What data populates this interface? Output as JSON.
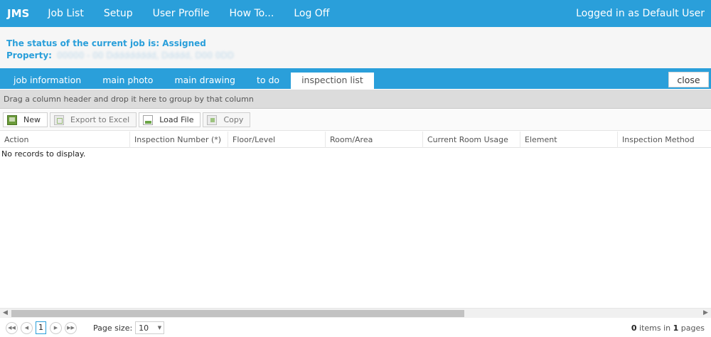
{
  "nav": {
    "brand": "JMS",
    "links": [
      "Job List",
      "Setup",
      "User Profile",
      "How To...",
      "Log Off"
    ],
    "user": "Logged in as Default User"
  },
  "status": {
    "line1": "The status of the current job is: Assigned",
    "property_label": "Property:",
    "property_value": "00000 - 00 Ddddddddd, Ddddd, D00 0DD"
  },
  "tabs": {
    "items": [
      "job information",
      "main photo",
      "main drawing",
      "to do",
      "inspection list"
    ],
    "active": "inspection list",
    "close": "close"
  },
  "grid": {
    "group_hint": "Drag a column header and drop it here to group by that column",
    "toolbar": {
      "new": "New",
      "export": "Export to Excel",
      "load": "Load File",
      "copy": "Copy"
    },
    "columns": [
      "Action",
      "Inspection Number (*)",
      "Floor/Level",
      "Room/Area",
      "Current Room Usage",
      "Element",
      "Inspection Method"
    ],
    "empty": "No records to display."
  },
  "pager": {
    "current_page": "1",
    "page_size_label": "Page size:",
    "page_size": "10",
    "items_count": "0",
    "items_text": " items in ",
    "pages_count": "1",
    "pages_text": " pages"
  },
  "colors": {
    "accent": "#2a9fda",
    "group_panel": "#dcdcdc",
    "status_bg": "#f6f6f6"
  }
}
